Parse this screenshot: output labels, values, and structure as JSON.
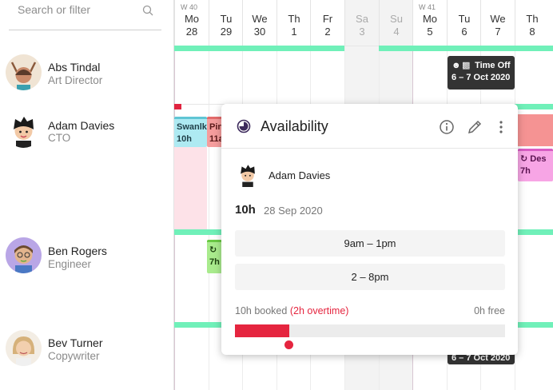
{
  "search": {
    "placeholder": "Search or filter"
  },
  "days": [
    {
      "week": "W 40",
      "name": "Mo",
      "num": "28",
      "weekend": false
    },
    {
      "week": "",
      "name": "Tu",
      "num": "29",
      "weekend": false
    },
    {
      "week": "",
      "name": "We",
      "num": "30",
      "weekend": false
    },
    {
      "week": "",
      "name": "Th",
      "num": "1",
      "weekend": false
    },
    {
      "week": "",
      "name": "Fr",
      "num": "2",
      "weekend": false
    },
    {
      "week": "",
      "name": "Sa",
      "num": "3",
      "weekend": true
    },
    {
      "week": "",
      "name": "Su",
      "num": "4",
      "weekend": true
    },
    {
      "week": "W 41",
      "name": "Mo",
      "num": "5",
      "weekend": false
    },
    {
      "week": "",
      "name": "Tu",
      "num": "6",
      "weekend": false
    },
    {
      "week": "",
      "name": "We",
      "num": "7",
      "weekend": false
    },
    {
      "week": "",
      "name": "Th",
      "num": "8",
      "weekend": false
    }
  ],
  "people": [
    {
      "name": "Abs Tindal",
      "role": "Art Director"
    },
    {
      "name": "Adam Davies",
      "role": "CTO"
    },
    {
      "name": "Ben Rogers",
      "role": "Engineer"
    },
    {
      "name": "Bev Turner",
      "role": "Copywriter"
    }
  ],
  "bars": {
    "time_off": {
      "label": "Time Off",
      "dates": "6 – 7 Oct 2020"
    },
    "time_off_bev": {
      "dates": "6 – 7 Oct 2020"
    },
    "swanlake": {
      "label": "Swanlk",
      "hours": "10h"
    },
    "pink": {
      "label": "Pin",
      "hours": "11a"
    },
    "design": {
      "label": "Des",
      "hours": "7h"
    },
    "ben_task": {
      "hours": "7h"
    }
  },
  "popover": {
    "title": "Availability",
    "user": "Adam Davies",
    "hours": "10h",
    "date": "28 Sep 2020",
    "slots": [
      "9am – 1pm",
      "2 – 8pm"
    ],
    "booked": "10h booked",
    "overtime": "(2h overtime)",
    "free": "0h free",
    "booked_fraction": 0.2
  },
  "colors": {
    "accent": "#e5253f",
    "availability": "#70f0b9",
    "time_off": "#333333"
  }
}
